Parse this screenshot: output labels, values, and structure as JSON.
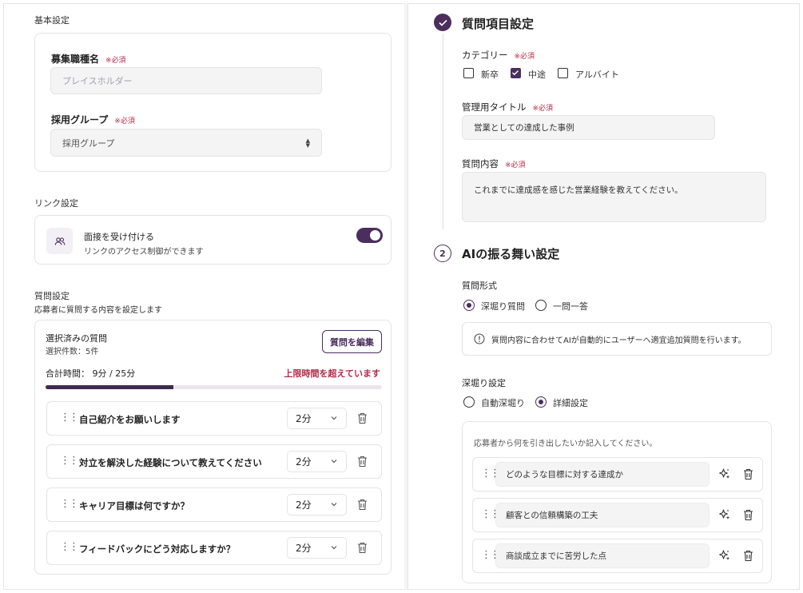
{
  "basic": {
    "section_title": "基本設定",
    "job_label": "募集職種名",
    "job_placeholder": "プレイスホルダー",
    "group_label": "採用グループ",
    "group_value": "採用グループ",
    "required_mark": "※必須"
  },
  "link": {
    "section_title": "リンク設定",
    "title": "面接を受け付ける",
    "subtitle": "リンクのアクセス制御ができます",
    "toggle_on": true
  },
  "questions": {
    "section_title": "質問設定",
    "section_subtitle": "応募者に質問する内容を設定します",
    "selected_title": "選択済みの質問",
    "selected_count": "選択件数：5件",
    "edit_button": "質問を編集",
    "total_label": "合計時間：",
    "total_value": "9分 / 25分",
    "over_limit": "上限時間を超えています",
    "progress": 0.38,
    "items": [
      {
        "text": "自己紹介をお願いします",
        "duration": "2分"
      },
      {
        "text": "対立を解決した経験について教えてください",
        "duration": "2分"
      },
      {
        "text": "キャリア目標は何ですか？",
        "duration": "2分"
      },
      {
        "text": "フィードバックにどう対応しますか？",
        "duration": "2分"
      }
    ]
  },
  "step1": {
    "title": "質問項目設定",
    "category_label": "カテゴリー",
    "categories": [
      {
        "label": "新卒",
        "checked": false
      },
      {
        "label": "中途",
        "checked": true
      },
      {
        "label": "アルバイト",
        "checked": false
      }
    ],
    "admin_title_label": "管理用タイトル",
    "admin_title_value": "営業としての達成した事例",
    "content_label": "質問内容",
    "content_value": "これまでに達成感を感じた営業経験を教えてください。",
    "required_mark": "※必須"
  },
  "step2": {
    "number": "2",
    "title": "AIの振る舞い設定",
    "format_label": "質問形式",
    "format_options": [
      {
        "label": "深堀り質問",
        "selected": true
      },
      {
        "label": "一問一答",
        "selected": false
      }
    ],
    "notice": "質問内容に合わせてAIが自動的にユーザーへ適宜追加質問を行います。",
    "deep_label": "深堀り設定",
    "deep_options": [
      {
        "label": "自動深堀り",
        "selected": false
      },
      {
        "label": "詳細設定",
        "selected": true
      }
    ],
    "guide": "応募者から何を引き出したいか記入してください。",
    "items": [
      {
        "text": "どのような目標に対する達成か"
      },
      {
        "text": "顧客との信頼構築の工夫"
      },
      {
        "text": "商談成立までに苦労した点"
      }
    ]
  },
  "colors": {
    "accent": "#4b2e5e",
    "required": "#b32a4a",
    "over_limit": "#b32a4a"
  }
}
